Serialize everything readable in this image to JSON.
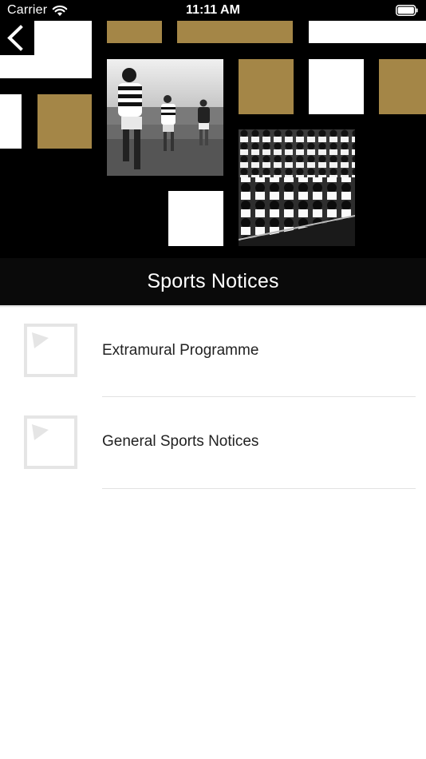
{
  "status_bar": {
    "carrier": "Carrier",
    "time": "11:11 AM",
    "icons": [
      "wifi-icon",
      "battery-icon"
    ]
  },
  "header": {
    "back_icon": "chevron-left-icon",
    "title": "Sports Notices",
    "colors": {
      "gold": "#a48647",
      "background": "#000000",
      "title_bar": "#0a0a0a"
    }
  },
  "list": {
    "items": [
      {
        "label": "Extramural Programme",
        "icon": "image-placeholder-icon"
      },
      {
        "label": "General Sports Notices",
        "icon": "image-placeholder-icon"
      }
    ]
  }
}
